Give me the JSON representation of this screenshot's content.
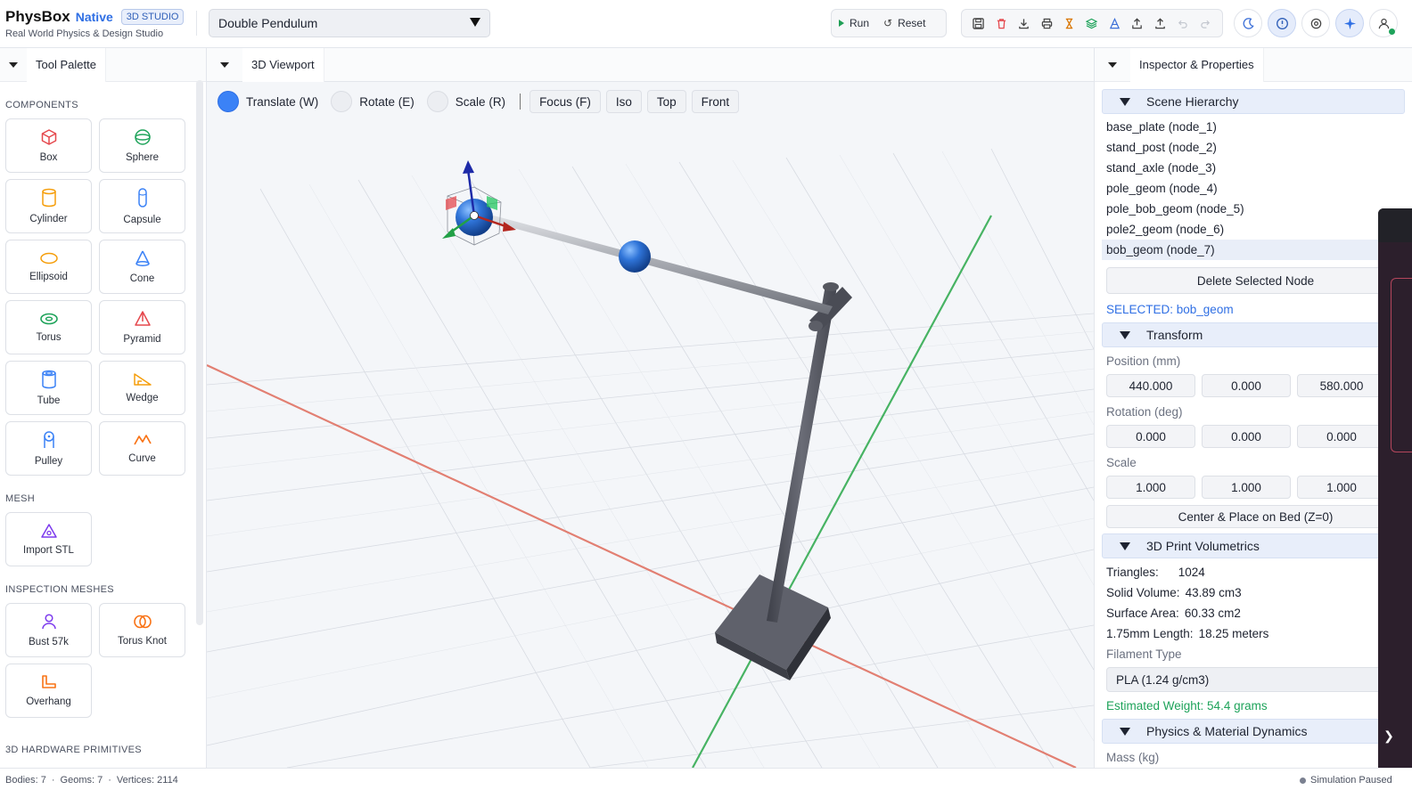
{
  "header": {
    "brand_name": "PhysBox",
    "brand_native": "Native",
    "brand_badge": "3D STUDIO",
    "brand_sub": "Real World Physics & Design Studio",
    "scene_select_value": "Double Pendulum",
    "run_label": "Run",
    "reset_label": "Reset"
  },
  "left_panel": {
    "tab_label": "Tool Palette",
    "sections": [
      {
        "title": "COMPONENTS",
        "items": [
          {
            "label": "Box",
            "icon": "box-icon",
            "color": "#e5484d"
          },
          {
            "label": "Sphere",
            "icon": "sphere-icon",
            "color": "#1ea35a"
          },
          {
            "label": "Cylinder",
            "icon": "cylinder-icon",
            "color": "#f59e0b"
          },
          {
            "label": "Capsule",
            "icon": "capsule-icon",
            "color": "#3b82f6"
          },
          {
            "label": "Ellipsoid",
            "icon": "ellipsoid-icon",
            "color": "#f59e0b"
          },
          {
            "label": "Cone",
            "icon": "cone-icon",
            "color": "#3b82f6"
          },
          {
            "label": "Torus",
            "icon": "torus-icon",
            "color": "#1ea35a"
          },
          {
            "label": "Pyramid",
            "icon": "pyramid-icon",
            "color": "#e5484d"
          },
          {
            "label": "Tube",
            "icon": "tube-icon",
            "color": "#3b82f6"
          },
          {
            "label": "Wedge",
            "icon": "wedge-icon",
            "color": "#f59e0b"
          },
          {
            "label": "Pulley",
            "icon": "pulley-icon",
            "color": "#3b82f6"
          },
          {
            "label": "Curve",
            "icon": "curve-icon",
            "color": "#f97316"
          }
        ]
      },
      {
        "title": "MESH",
        "items": [
          {
            "label": "Import STL",
            "icon": "import-stl-icon",
            "color": "#7c3aed"
          }
        ]
      },
      {
        "title": "INSPECTION MESHES",
        "items": [
          {
            "label": "Bust 57k",
            "icon": "bust-icon",
            "color": "#7c3aed"
          },
          {
            "label": "Torus Knot",
            "icon": "torus-knot-icon",
            "color": "#f97316"
          },
          {
            "label": "Overhang",
            "icon": "overhang-icon",
            "color": "#f97316"
          }
        ]
      },
      {
        "title": "3D HARDWARE PRIMITIVES",
        "items": []
      }
    ]
  },
  "viewport": {
    "tab_label": "3D Viewport",
    "modes": [
      {
        "label": "Translate (W)",
        "active": true
      },
      {
        "label": "Rotate (E)",
        "active": false
      },
      {
        "label": "Scale (R)",
        "active": false
      }
    ],
    "views": [
      "Focus (F)",
      "Iso",
      "Top",
      "Front"
    ]
  },
  "inspector": {
    "tab_label": "Inspector & Properties",
    "scene_hierarchy_title": "Scene Hierarchy",
    "nodes": [
      {
        "label": "base_plate (node_1)",
        "selected": false
      },
      {
        "label": "stand_post (node_2)",
        "selected": false
      },
      {
        "label": "stand_axle (node_3)",
        "selected": false
      },
      {
        "label": "pole_geom (node_4)",
        "selected": false
      },
      {
        "label": "pole_bob_geom (node_5)",
        "selected": false
      },
      {
        "label": "pole2_geom (node_6)",
        "selected": false
      },
      {
        "label": "bob_geom (node_7)",
        "selected": true
      }
    ],
    "delete_label": "Delete Selected Node",
    "selected_text": "SELECTED: bob_geom",
    "transform_title": "Transform",
    "position_label": "Position (mm)",
    "position": [
      "440.000",
      "0.000",
      "580.000"
    ],
    "rotation_label": "Rotation (deg)",
    "rotation": [
      "0.000",
      "0.000",
      "0.000"
    ],
    "scale_label": "Scale",
    "scale": [
      "1.000",
      "1.000",
      "1.000"
    ],
    "center_place_label": "Center & Place on Bed (Z=0)",
    "volumetrics_title": "3D Print Volumetrics",
    "triangles_label": "Triangles:",
    "triangles_value": "1024",
    "solid_volume_label": "Solid Volume:",
    "solid_volume_value": "43.89 cm3",
    "surface_area_label": "Surface Area:",
    "surface_area_value": "60.33 cm2",
    "length_label": "1.75mm Length:",
    "length_value": "18.25 meters",
    "filament_type_label": "Filament Type",
    "filament_type_value": "PLA (1.24 g/cm3)",
    "estimated_weight": "Estimated Weight: 54.4 grams",
    "physics_title": "Physics & Material Dynamics",
    "mass_label": "Mass (kg)"
  },
  "drawer": {
    "handle_glyph": "❯"
  },
  "statusbar": {
    "bodies": "Bodies: 7",
    "geoms": "Geoms: 7",
    "vertices": "Vertices: 2114",
    "separator": "·",
    "sim_status": "Simulation Paused"
  },
  "colors": {
    "accent": "#2f6fe4",
    "success": "#1ea35a",
    "x_axis": "#e06b5b",
    "z_axis": "#2aa84a"
  }
}
